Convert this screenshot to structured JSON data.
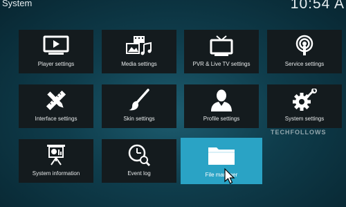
{
  "header": {
    "title": "System",
    "clock": "10:54 A"
  },
  "tiles": [
    {
      "label": "Player settings",
      "icon": "monitor-play-icon"
    },
    {
      "label": "Media settings",
      "icon": "media-icon"
    },
    {
      "label": "PVR & Live TV settings",
      "icon": "tv-antenna-icon"
    },
    {
      "label": "Service settings",
      "icon": "podcast-icon"
    },
    {
      "label": "Interface settings",
      "icon": "pencil-ruler-icon"
    },
    {
      "label": "Skin settings",
      "icon": "paintbrush-icon"
    },
    {
      "label": "Profile settings",
      "icon": "user-icon"
    },
    {
      "label": "System settings",
      "icon": "gear-wrench-icon"
    },
    {
      "label": "System information",
      "icon": "presentation-icon"
    },
    {
      "label": "Event log",
      "icon": "clock-search-icon"
    },
    {
      "label": "File manager",
      "icon": "folder-icon"
    }
  ],
  "selected_tile": "File manager",
  "watermark": "TECHFOLLOWS",
  "colors": {
    "tile_bg": "#141b1e",
    "selected_bg": "#2aa3c5",
    "background": "#0f3d4c"
  }
}
